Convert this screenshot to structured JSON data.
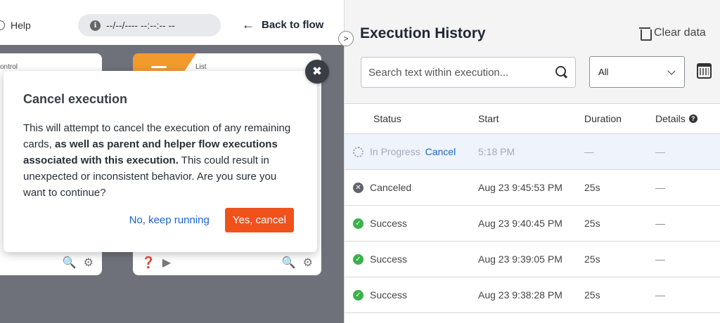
{
  "canvas": {
    "help_label": "Help",
    "date_filter": "--/--/---- --:--:-- --",
    "back_label": "Back to flow",
    "card1_label": "ontrol",
    "card2_label": "List"
  },
  "modal": {
    "title": "Cancel execution",
    "body_part1": "This will attempt to cancel the execution of any remaining cards, ",
    "body_bold": "as well as parent and helper flow executions associated with this execution.",
    "body_part2": " This could result in unexpected or inconsistent behavior. Are you sure you want to continue?",
    "secondary_label": "No, keep running",
    "primary_label": "Yes, cancel"
  },
  "panel": {
    "title": "Execution History",
    "clear_label": "Clear data",
    "search_placeholder": "Search text within execution...",
    "filter_value": "All",
    "columns": {
      "status": "Status",
      "start": "Start",
      "duration": "Duration",
      "details": "Details"
    },
    "rows": [
      {
        "status": "In Progress",
        "action": "Cancel",
        "start": "5:18 PM",
        "duration": "—",
        "details": "—",
        "icon": "spinner-icon"
      },
      {
        "status": "Canceled",
        "start": "Aug 23 9:45:53 PM",
        "duration": "25s",
        "details": "—",
        "icon": "canceled-icon"
      },
      {
        "status": "Success",
        "start": "Aug 23 9:40:45 PM",
        "duration": "25s",
        "details": "—",
        "icon": "success-icon"
      },
      {
        "status": "Success",
        "start": "Aug 23 9:39:05 PM",
        "duration": "25s",
        "details": "—",
        "icon": "success-icon"
      },
      {
        "status": "Success",
        "start": "Aug 23 9:38:28 PM",
        "duration": "25s",
        "details": "—",
        "icon": "success-icon"
      }
    ]
  },
  "colors": {
    "accent_blue": "#1b65c9",
    "primary_orange": "#f0521c",
    "success_green": "#3bb14a",
    "canvas_gray": "#6e7179"
  }
}
